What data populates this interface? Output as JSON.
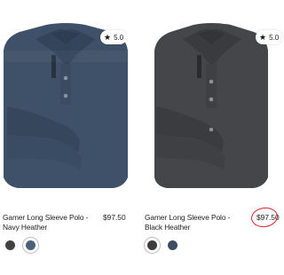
{
  "products": [
    {
      "name": "Gamer Long Sleeve Polo - Navy Heather",
      "price": "$97.50",
      "rating": "5.0",
      "swatches": [
        {
          "label": "Charcoal",
          "color": "#3f4144",
          "selected": false
        },
        {
          "label": "Navy Heather",
          "color": "#4d6077",
          "selected": true
        }
      ],
      "shirt_color": "#3e5068"
    },
    {
      "name": "Gamer Long Sleeve Polo - Black Heather",
      "price": "$97.50",
      "rating": "5.0",
      "swatches": [
        {
          "label": "Charcoal",
          "color": "#3a3c3f",
          "selected": true
        },
        {
          "label": "Navy Heather",
          "color": "#3d4d61",
          "selected": false
        }
      ],
      "shirt_color": "#444548"
    }
  ],
  "icons": {
    "rating": "star-icon"
  },
  "colors": {
    "annotation_circle": "#d0242b"
  }
}
